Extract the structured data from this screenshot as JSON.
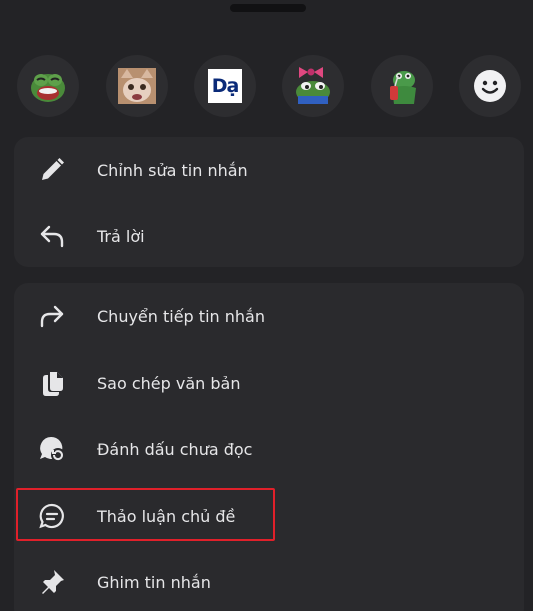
{
  "reactions": [
    {
      "name": "pepe-laugh-sticker"
    },
    {
      "name": "cat-face-sticker"
    },
    {
      "name": "da-sticker",
      "text": "Dạ"
    },
    {
      "name": "pepe-bow-sticker"
    },
    {
      "name": "frog-drink-sticker"
    },
    {
      "name": "smile-emoji"
    }
  ],
  "menu": {
    "group1": [
      {
        "label": "Chỉnh sửa tin nhắn",
        "icon": "pencil-icon"
      },
      {
        "label": "Trả lời",
        "icon": "reply-icon"
      }
    ],
    "group2": [
      {
        "label": "Chuyển tiếp tin nhắn",
        "icon": "forward-icon"
      },
      {
        "label": "Sao chép văn bản",
        "icon": "copy-icon"
      },
      {
        "label": "Đánh dấu chưa đọc",
        "icon": "mark-unread-icon"
      },
      {
        "label": "Thảo luận chủ đề",
        "icon": "thread-icon"
      },
      {
        "label": "Ghim tin nhắn",
        "icon": "pin-icon"
      }
    ]
  },
  "colors": {
    "background": "#232326",
    "card": "#2a2a2d",
    "text": "#e6e6e8",
    "highlight": "#e0202a"
  }
}
